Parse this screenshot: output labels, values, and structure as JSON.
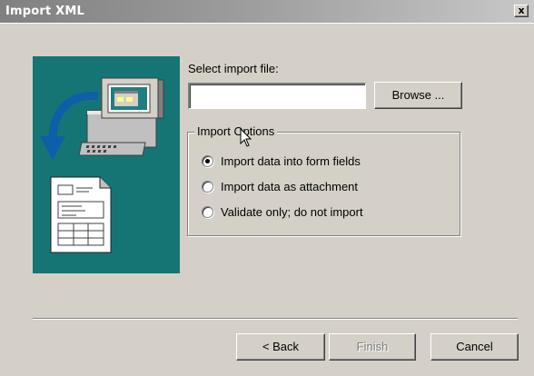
{
  "window": {
    "title": "Import XML",
    "close_glyph": "x"
  },
  "illustration": {
    "background": "#157575",
    "icons": [
      "computer-icon",
      "curved-arrow-icon",
      "document-icon"
    ]
  },
  "file_select": {
    "label": "Select import file:",
    "value": "",
    "browse_label": "Browse ..."
  },
  "import_options": {
    "legend": "Import Options",
    "options": [
      {
        "label": "Import data into form fields",
        "selected": true
      },
      {
        "label": "Import data as attachment",
        "selected": false
      },
      {
        "label": "Validate only; do not import",
        "selected": false
      }
    ]
  },
  "footer": {
    "back_label": "< Back",
    "finish_label": "Finish",
    "finish_enabled": false,
    "cancel_label": "Cancel"
  },
  "colors": {
    "dialog_bg": "#d4d0c8",
    "title_start": "#808080",
    "title_end": "#c8c8c8",
    "illustration_bg": "#157575",
    "disabled_text": "#808080"
  }
}
